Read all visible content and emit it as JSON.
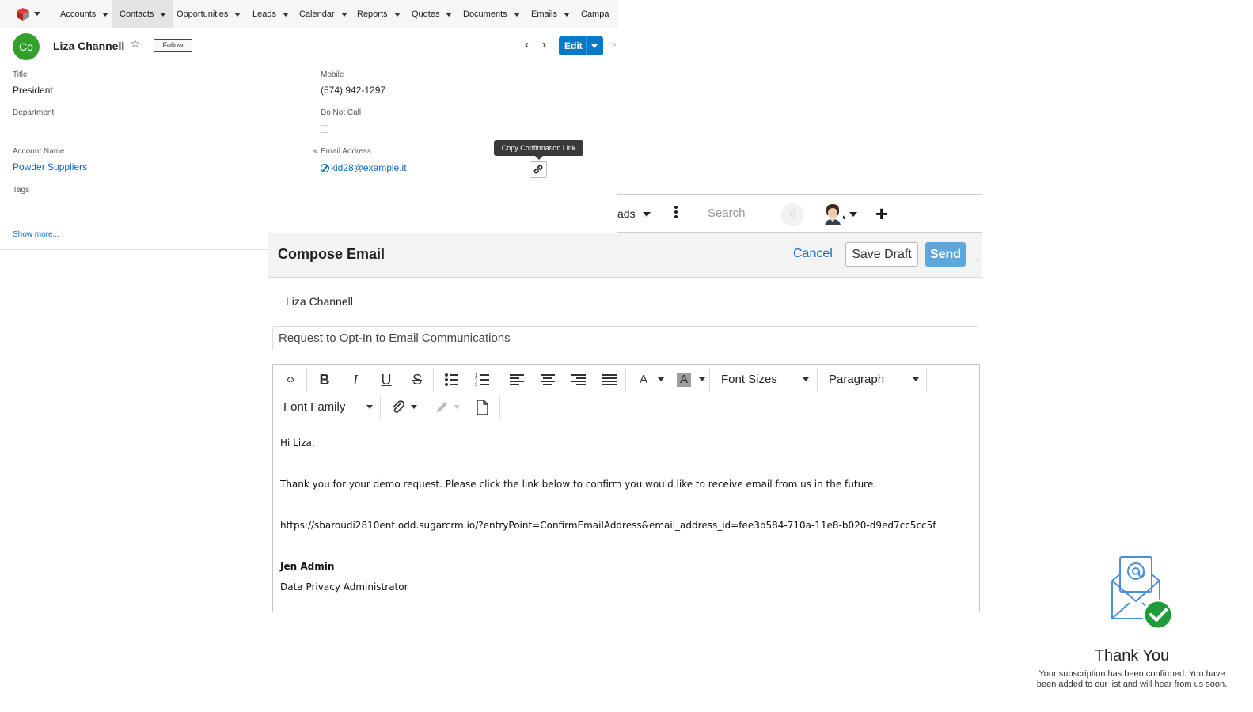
{
  "crm_nav": {
    "tabs": [
      {
        "label": "Accounts",
        "active": false
      },
      {
        "label": "Contacts",
        "active": true
      },
      {
        "label": "Opportunities",
        "active": false
      },
      {
        "label": "Leads",
        "active": false
      },
      {
        "label": "Calendar",
        "active": false
      },
      {
        "label": "Reports",
        "active": false
      },
      {
        "label": "Quotes",
        "active": false
      },
      {
        "label": "Documents",
        "active": false
      },
      {
        "label": "Emails",
        "active": false
      },
      {
        "label": "Campa",
        "active": false
      }
    ]
  },
  "record": {
    "avatar_initials": "Co",
    "avatar_color": "#33a02c",
    "name": "Liza Channell",
    "follow_label": "Follow",
    "edit_label": "Edit",
    "fields": {
      "title_label": "Title",
      "title_value": "President",
      "mobile_label": "Mobile",
      "mobile_value": "(574) 942-1297",
      "department_label": "Department",
      "do_not_call_label": "Do Not Call",
      "account_label": "Account Name",
      "account_value": "Powder Suppliers",
      "email_label": "Email Address",
      "email_value": "kid28@example.it",
      "tags_label": "Tags"
    },
    "tooltip": "Copy Confirmation Link",
    "show_more": "Show more..."
  },
  "topbar": {
    "leads_label": "ads",
    "search_placeholder": "Search",
    "notification_count": "0"
  },
  "compose": {
    "title": "Compose Email",
    "cancel_label": "Cancel",
    "save_draft_label": "Save Draft",
    "send_label": "Send",
    "send_color": "#5ea7dd",
    "recipient": "Liza Channell",
    "subject": "Request to Opt-In to Email Communications",
    "toolbar": {
      "font_sizes_label": "Font Sizes",
      "paragraph_label": "Paragraph",
      "font_family_label": "Font Family"
    },
    "body": {
      "greeting": "Hi Liza,",
      "line1": "Thank you for your demo request. Please click the link below to confirm you would like to receive email from us in the future.",
      "link": "https://sbaroudi2810ent.odd.sugarcrm.io/?entryPoint=ConfirmEmailAddress&email_address_id=fee3b584-710a-11e8-b020-d9ed7cc5cc5f",
      "signature_name": "Jen Admin",
      "signature_title": "Data Privacy Administrator"
    }
  },
  "thank_you": {
    "title": "Thank You",
    "message_line1": "Your subscription has been confirmed. You have",
    "message_line2": "been added to our list and will hear from us soon.",
    "accent_color": "#1f9d3a",
    "envelope_color": "#4a90d9"
  }
}
